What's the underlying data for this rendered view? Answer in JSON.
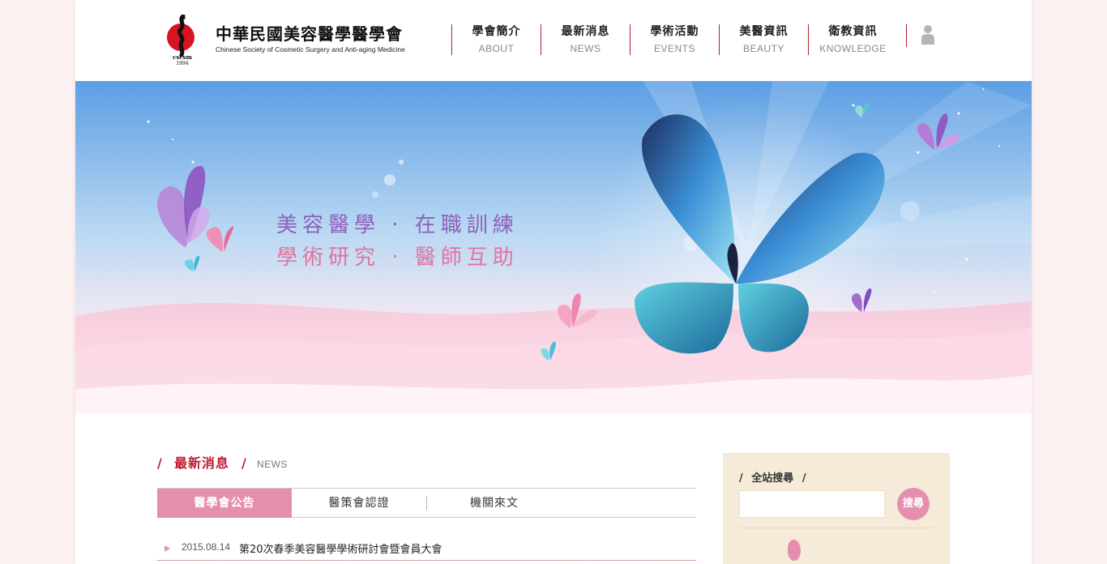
{
  "header": {
    "logo": {
      "name_cn": "中華民國美容醫學醫學會",
      "name_en": "Chinese Society of Cosmetic Surgery and Anti-aging Medicine",
      "abbr": "cscsm",
      "year": "1994"
    },
    "nav": [
      {
        "cn": "學會簡介",
        "en": "ABOUT"
      },
      {
        "cn": "最新消息",
        "en": "NEWS"
      },
      {
        "cn": "學術活動",
        "en": "EVENTS"
      },
      {
        "cn": "美醫資訊",
        "en": "BEAUTY"
      },
      {
        "cn": "衛教資訊",
        "en": "KNOWLEDGE"
      }
    ],
    "member_icon": "user-icon"
  },
  "banner": {
    "slogan_line1": "美容醫學 ‧ 在職訓練",
    "slogan_line2": "學術研究 ‧ 醫師互助"
  },
  "news": {
    "slash": "/",
    "title": "最新消息",
    "subtitle": "NEWS",
    "tabs": [
      {
        "label": "醫學會公告",
        "active": true
      },
      {
        "label": "醫策會認證",
        "active": false
      },
      {
        "label": "機關來文",
        "active": false
      }
    ],
    "items": [
      {
        "date": "2015.08.14",
        "text": "第20次春季美容醫學學術研討會暨會員大會"
      }
    ]
  },
  "search": {
    "slash": "/",
    "title": "全站搜尋",
    "placeholder": "",
    "button_label": "搜尋"
  },
  "colors": {
    "accent_red": "#c1182c",
    "accent_pink": "#e58fae",
    "search_bg": "#f6ebd9",
    "page_bg": "#fcf1f1"
  }
}
